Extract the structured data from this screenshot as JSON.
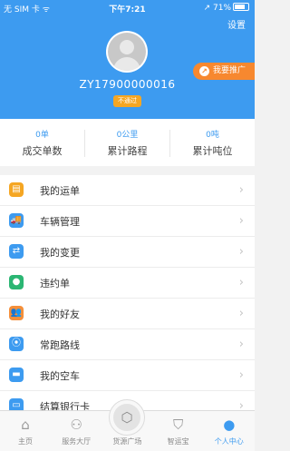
{
  "status_bar": {
    "carrier": "无 SIM 卡 ᯤ",
    "time": "下午7:21",
    "battery": "↗ 71%"
  },
  "header": {
    "settings": "设置",
    "user_id": "ZY17900000016",
    "verify_badge": "不通过",
    "promo_label": "我要推广",
    "promo_icon": "share-icon"
  },
  "stats": [
    {
      "value": "0单",
      "label": "成交单数"
    },
    {
      "value": "0公里",
      "label": "累计路程"
    },
    {
      "value": "0吨",
      "label": "累计吨位"
    }
  ],
  "menu": [
    {
      "label": "我的运单",
      "icon": "waybill-icon",
      "color": "#f5a623",
      "glyph": "▤"
    },
    {
      "label": "车辆管理",
      "icon": "truck-icon",
      "color": "#3d9bf0",
      "glyph": "🚚"
    },
    {
      "label": "我的变更",
      "icon": "shuffle-icon",
      "color": "#3d9bf0",
      "glyph": "⇄"
    },
    {
      "label": "违约单",
      "icon": "breach-icon",
      "color": "#2bb673",
      "glyph": "●"
    },
    {
      "label": "我的好友",
      "icon": "friends-icon",
      "color": "#f58f3a",
      "glyph": "👥"
    },
    {
      "label": "常跑路线",
      "icon": "route-icon",
      "color": "#3d9bf0",
      "glyph": "⦿"
    },
    {
      "label": "我的空车",
      "icon": "empty-truck-icon",
      "color": "#3d9bf0",
      "glyph": "▬"
    },
    {
      "label": "结算银行卡",
      "icon": "bank-card-icon",
      "color": "#3d9bf0",
      "glyph": "▭"
    }
  ],
  "tabbar": [
    {
      "label": "主页",
      "icon": "home-icon",
      "glyph": "⌂"
    },
    {
      "label": "服务大厅",
      "icon": "services-icon",
      "glyph": "⚇"
    },
    {
      "label": "货源广场",
      "icon": "cargo-box-icon",
      "glyph": "⬡"
    },
    {
      "label": "智运宝",
      "icon": "shield-icon",
      "glyph": "⛉"
    },
    {
      "label": "个人中心",
      "icon": "person-icon",
      "glyph": "●"
    }
  ],
  "active_tab": "个人中心",
  "colors": {
    "primary": "#3d9bf0",
    "promo": "#f7882f",
    "badge": "#f5a623"
  }
}
